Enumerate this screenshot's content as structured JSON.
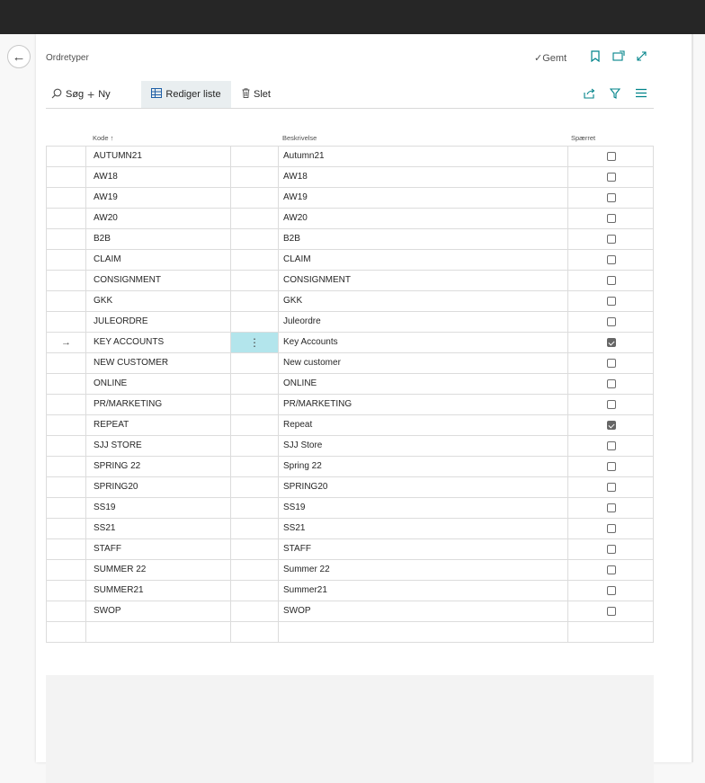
{
  "page": {
    "title": "Ordretyper",
    "saved_label": "Gemt"
  },
  "actions": {
    "search": "Søg",
    "new": "Ny",
    "edit_list": "Rediger liste",
    "delete": "Slet"
  },
  "columns": {
    "code": "Kode ↑",
    "description": "Beskrivelse",
    "blocked": "Spærret"
  },
  "active_marker": "→",
  "row_menu": "⋮",
  "rows": [
    {
      "code": "AUTUMN21",
      "description": "Autumn21",
      "blocked": false
    },
    {
      "code": "AW18",
      "description": "AW18",
      "blocked": false
    },
    {
      "code": "AW19",
      "description": "AW19",
      "blocked": false
    },
    {
      "code": "AW20",
      "description": "AW20",
      "blocked": false
    },
    {
      "code": "B2B",
      "description": "B2B",
      "blocked": false
    },
    {
      "code": "CLAIM",
      "description": "CLAIM",
      "blocked": false
    },
    {
      "code": "CONSIGNMENT",
      "description": "CONSIGNMENT",
      "blocked": false
    },
    {
      "code": "GKK",
      "description": "GKK",
      "blocked": false
    },
    {
      "code": "JULEORDRE",
      "description": "Juleordre",
      "blocked": false
    },
    {
      "code": "KEY ACCOUNTS",
      "description": "Key Accounts",
      "blocked": true,
      "active": true
    },
    {
      "code": "NEW CUSTOMER",
      "description": "New customer",
      "blocked": false
    },
    {
      "code": "ONLINE",
      "description": "ONLINE",
      "blocked": false
    },
    {
      "code": "PR/MARKETING",
      "description": "PR/MARKETING",
      "blocked": false
    },
    {
      "code": "REPEAT",
      "description": "Repeat",
      "blocked": true
    },
    {
      "code": "SJJ STORE",
      "description": "SJJ Store",
      "blocked": false
    },
    {
      "code": "SPRING 22",
      "description": "Spring 22",
      "blocked": false
    },
    {
      "code": "SPRING20",
      "description": "SPRING20",
      "blocked": false
    },
    {
      "code": "SS19",
      "description": "SS19",
      "blocked": false
    },
    {
      "code": "SS21",
      "description": "SS21",
      "blocked": false
    },
    {
      "code": "STAFF",
      "description": "STAFF",
      "blocked": false
    },
    {
      "code": "SUMMER 22",
      "description": "Summer 22",
      "blocked": false
    },
    {
      "code": "SUMMER21",
      "description": "Summer21",
      "blocked": false
    },
    {
      "code": "SWOP",
      "description": "SWOP",
      "blocked": false
    }
  ]
}
